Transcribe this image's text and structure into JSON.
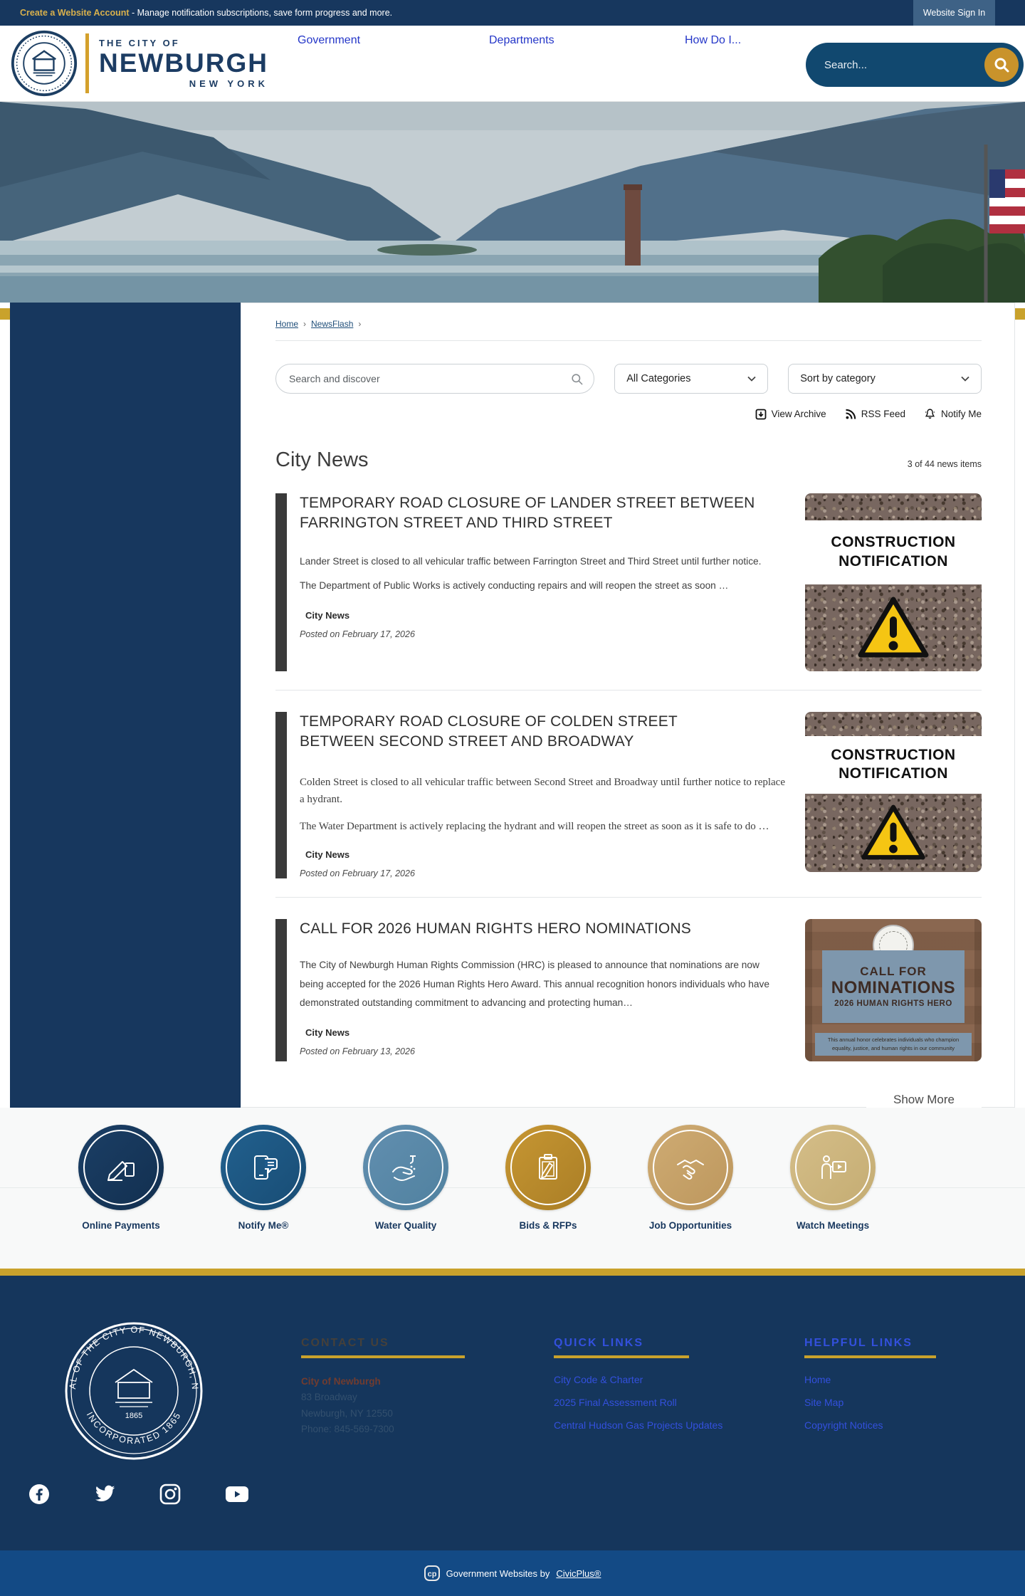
{
  "topbar": {
    "account_bold": "Create a Website Account",
    "account_rest": " - Manage notification subscriptions, save form progress and more.",
    "signin": "Website Sign In"
  },
  "header": {
    "pretitle": "THE CITY OF",
    "city": "NEWBURGH",
    "state": "NEW YORK",
    "nav": [
      {
        "label": "Government"
      },
      {
        "label": "Departments"
      },
      {
        "label": "How Do I..."
      }
    ],
    "search_placeholder": "Search..."
  },
  "seal": {
    "top_text": "SEAL OF THE CITY OF NEWBURGH, N.Y.",
    "bottom_text": "INCORPORATED 1865"
  },
  "breadcrumb": {
    "home": "Home",
    "newsflash": "NewsFlash",
    "separator": "›"
  },
  "filters": {
    "search_placeholder": "Search and discover",
    "category": "All Categories",
    "sort": "Sort by category"
  },
  "actions": {
    "view_archive": "View Archive",
    "rss": "RSS Feed",
    "notify": "Notify Me"
  },
  "news": {
    "heading": "City News",
    "count": "3 of 44 news items",
    "show_more": "Show More",
    "items": [
      {
        "title": "TEMPORARY ROAD CLOSURE OF LANDER STREET BETWEEN FARRINGTON STREET AND THIRD STREET",
        "body": [
          "Lander Street is closed to all vehicular traffic between Farrington Street and Third Street until further notice.",
          "The Department of Public Works is actively conducting repairs and will reopen the street as soon …"
        ],
        "category": "City News",
        "posted": "Posted on February 17, 2026",
        "image": {
          "line1": "CONSTRUCTION",
          "line2": "NOTIFICATION"
        }
      },
      {
        "title": "TEMPORARY ROAD CLOSURE OF COLDEN STREET BETWEEN SECOND STREET AND BROADWAY",
        "body": [
          "Colden Street is closed to all vehicular traffic between Second Street and Broadway until further notice to replace a hydrant.",
          "The Water Department is actively replacing the hydrant and will reopen the street as soon as it is safe to do …"
        ],
        "category": "City News",
        "posted": "Posted on February 17, 2026",
        "image": {
          "line1": "CONSTRUCTION",
          "line2": "NOTIFICATION"
        }
      },
      {
        "title": "CALL FOR 2026 HUMAN RIGHTS HERO NOMINATIONS",
        "body": [
          "The City of Newburgh Human Rights Commission (HRC) is pleased to announce that nominations are now being accepted for the 2026 Human Rights Hero Award. This annual recognition honors individuals who have demonstrated outstanding commitment to advancing and protecting human…"
        ],
        "category": "City News",
        "posted": "Posted on February 13, 2026",
        "image": {
          "line1": "CALL FOR",
          "line2": "NOMINATIONS",
          "line3": "2026 HUMAN RIGHTS HERO",
          "caption1": "This annual honor celebrates individuals who champion",
          "caption2": "equality, justice, and human rights in our community"
        }
      }
    ]
  },
  "quicklinks": [
    {
      "label": "Online Payments",
      "color": "#17395E",
      "icon": "pen-signing-icon"
    },
    {
      "label": "Notify Me®",
      "color": "#1E5B8C",
      "icon": "phone-chat-icon"
    },
    {
      "label": "Water Quality",
      "color": "#5B88A8",
      "icon": "washing-hands-icon"
    },
    {
      "label": "Bids & RFPs",
      "color": "#BC8C2E",
      "icon": "clipboard-pencil-icon"
    },
    {
      "label": "Job Opportunities",
      "color": "#C6A269",
      "icon": "handshake-icon"
    },
    {
      "label": "Watch Meetings",
      "color": "#CEB67F",
      "icon": "presenter-icon"
    }
  ],
  "footer": {
    "contact": {
      "heading": "CONTACT US",
      "org": "City of Newburgh",
      "address1": "83 Broadway",
      "address2": "Newburgh, NY 12550",
      "phone": "Phone: 845-569-7300"
    },
    "quick": {
      "heading": "QUICK LINKS",
      "links": [
        "City Code & Charter",
        "2025 Final Assessment Roll",
        "Central Hudson Gas Projects Updates"
      ]
    },
    "helpful": {
      "heading": "HELPFUL LINKS",
      "links": [
        "Home",
        "Site Map",
        "Copyright Notices"
      ]
    },
    "social": [
      "facebook",
      "twitter",
      "instagram",
      "youtube"
    ]
  },
  "bottombar": {
    "prefix": "Government Websites by",
    "brand": "CivicPlus®"
  },
  "colors": {
    "navy": "#17375E",
    "gold": "#C9A22C",
    "nav_blue": "#2436C8",
    "link_blue": "#3350DD",
    "footer_navy": "#15365C",
    "bottom_blue": "#134A85"
  }
}
